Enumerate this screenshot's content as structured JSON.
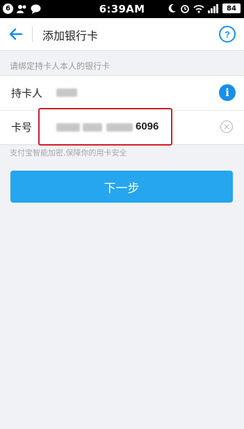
{
  "status_bar": {
    "notification_count": "6",
    "time": "6:39AM",
    "battery": "84",
    "battery_color": "#ffffff"
  },
  "header": {
    "title": "添加银行卡",
    "help_label": "?",
    "back_icon": "arrow-left-icon",
    "accent_color": "#1a8fe8"
  },
  "section_label": "请绑定持卡人本人的银行卡",
  "form": {
    "holder_label": "持卡人",
    "holder_info_icon": "i",
    "card_label": "卡号",
    "card_last4": "6096",
    "clear_icon": "×"
  },
  "hint": "支付宝智能加密,保障你的用卡安全",
  "next_button": {
    "label": "下一步",
    "color": "#26a6ee"
  }
}
